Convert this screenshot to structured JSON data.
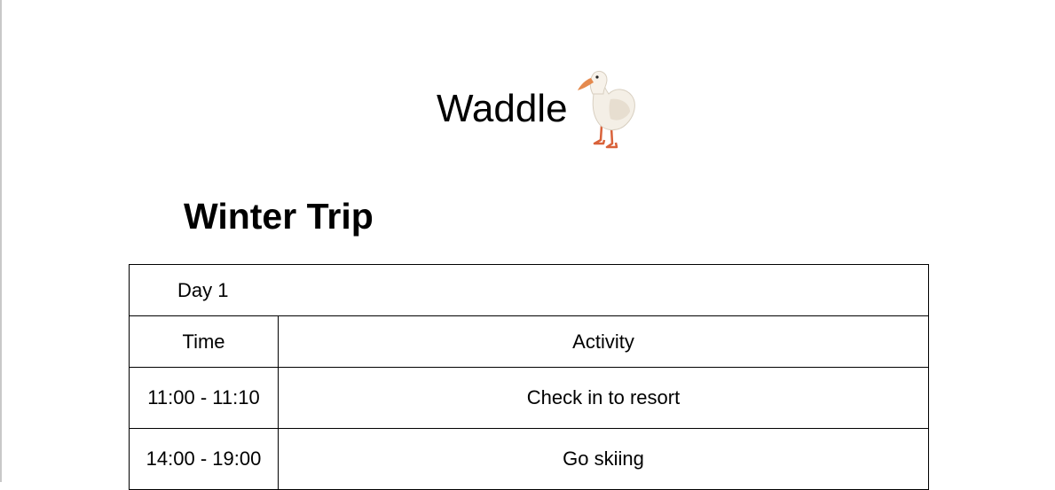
{
  "brand": {
    "name": "Waddle",
    "logo_icon": "duck-icon"
  },
  "document": {
    "title": "Winter Trip"
  },
  "schedule": {
    "day_label": "Day 1",
    "columns": [
      "Time",
      "Activity"
    ],
    "rows": [
      {
        "time": "11:00 - 11:10",
        "activity": "Check in to resort"
      },
      {
        "time": "14:00 - 19:00",
        "activity": "Go skiing"
      }
    ]
  }
}
